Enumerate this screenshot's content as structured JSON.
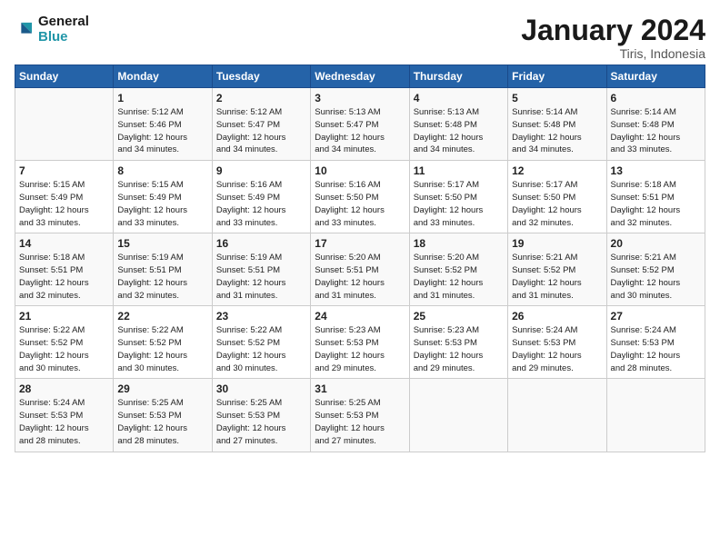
{
  "logo": {
    "line1": "General",
    "line2": "Blue"
  },
  "title": "January 2024",
  "subtitle": "Tiris, Indonesia",
  "days_header": [
    "Sunday",
    "Monday",
    "Tuesday",
    "Wednesday",
    "Thursday",
    "Friday",
    "Saturday"
  ],
  "weeks": [
    [
      {
        "day": "",
        "info": ""
      },
      {
        "day": "1",
        "info": "Sunrise: 5:12 AM\nSunset: 5:46 PM\nDaylight: 12 hours\nand 34 minutes."
      },
      {
        "day": "2",
        "info": "Sunrise: 5:12 AM\nSunset: 5:47 PM\nDaylight: 12 hours\nand 34 minutes."
      },
      {
        "day": "3",
        "info": "Sunrise: 5:13 AM\nSunset: 5:47 PM\nDaylight: 12 hours\nand 34 minutes."
      },
      {
        "day": "4",
        "info": "Sunrise: 5:13 AM\nSunset: 5:48 PM\nDaylight: 12 hours\nand 34 minutes."
      },
      {
        "day": "5",
        "info": "Sunrise: 5:14 AM\nSunset: 5:48 PM\nDaylight: 12 hours\nand 34 minutes."
      },
      {
        "day": "6",
        "info": "Sunrise: 5:14 AM\nSunset: 5:48 PM\nDaylight: 12 hours\nand 33 minutes."
      }
    ],
    [
      {
        "day": "7",
        "info": "Sunrise: 5:15 AM\nSunset: 5:49 PM\nDaylight: 12 hours\nand 33 minutes."
      },
      {
        "day": "8",
        "info": "Sunrise: 5:15 AM\nSunset: 5:49 PM\nDaylight: 12 hours\nand 33 minutes."
      },
      {
        "day": "9",
        "info": "Sunrise: 5:16 AM\nSunset: 5:49 PM\nDaylight: 12 hours\nand 33 minutes."
      },
      {
        "day": "10",
        "info": "Sunrise: 5:16 AM\nSunset: 5:50 PM\nDaylight: 12 hours\nand 33 minutes."
      },
      {
        "day": "11",
        "info": "Sunrise: 5:17 AM\nSunset: 5:50 PM\nDaylight: 12 hours\nand 33 minutes."
      },
      {
        "day": "12",
        "info": "Sunrise: 5:17 AM\nSunset: 5:50 PM\nDaylight: 12 hours\nand 32 minutes."
      },
      {
        "day": "13",
        "info": "Sunrise: 5:18 AM\nSunset: 5:51 PM\nDaylight: 12 hours\nand 32 minutes."
      }
    ],
    [
      {
        "day": "14",
        "info": "Sunrise: 5:18 AM\nSunset: 5:51 PM\nDaylight: 12 hours\nand 32 minutes."
      },
      {
        "day": "15",
        "info": "Sunrise: 5:19 AM\nSunset: 5:51 PM\nDaylight: 12 hours\nand 32 minutes."
      },
      {
        "day": "16",
        "info": "Sunrise: 5:19 AM\nSunset: 5:51 PM\nDaylight: 12 hours\nand 31 minutes."
      },
      {
        "day": "17",
        "info": "Sunrise: 5:20 AM\nSunset: 5:51 PM\nDaylight: 12 hours\nand 31 minutes."
      },
      {
        "day": "18",
        "info": "Sunrise: 5:20 AM\nSunset: 5:52 PM\nDaylight: 12 hours\nand 31 minutes."
      },
      {
        "day": "19",
        "info": "Sunrise: 5:21 AM\nSunset: 5:52 PM\nDaylight: 12 hours\nand 31 minutes."
      },
      {
        "day": "20",
        "info": "Sunrise: 5:21 AM\nSunset: 5:52 PM\nDaylight: 12 hours\nand 30 minutes."
      }
    ],
    [
      {
        "day": "21",
        "info": "Sunrise: 5:22 AM\nSunset: 5:52 PM\nDaylight: 12 hours\nand 30 minutes."
      },
      {
        "day": "22",
        "info": "Sunrise: 5:22 AM\nSunset: 5:52 PM\nDaylight: 12 hours\nand 30 minutes."
      },
      {
        "day": "23",
        "info": "Sunrise: 5:22 AM\nSunset: 5:52 PM\nDaylight: 12 hours\nand 30 minutes."
      },
      {
        "day": "24",
        "info": "Sunrise: 5:23 AM\nSunset: 5:53 PM\nDaylight: 12 hours\nand 29 minutes."
      },
      {
        "day": "25",
        "info": "Sunrise: 5:23 AM\nSunset: 5:53 PM\nDaylight: 12 hours\nand 29 minutes."
      },
      {
        "day": "26",
        "info": "Sunrise: 5:24 AM\nSunset: 5:53 PM\nDaylight: 12 hours\nand 29 minutes."
      },
      {
        "day": "27",
        "info": "Sunrise: 5:24 AM\nSunset: 5:53 PM\nDaylight: 12 hours\nand 28 minutes."
      }
    ],
    [
      {
        "day": "28",
        "info": "Sunrise: 5:24 AM\nSunset: 5:53 PM\nDaylight: 12 hours\nand 28 minutes."
      },
      {
        "day": "29",
        "info": "Sunrise: 5:25 AM\nSunset: 5:53 PM\nDaylight: 12 hours\nand 28 minutes."
      },
      {
        "day": "30",
        "info": "Sunrise: 5:25 AM\nSunset: 5:53 PM\nDaylight: 12 hours\nand 27 minutes."
      },
      {
        "day": "31",
        "info": "Sunrise: 5:25 AM\nSunset: 5:53 PM\nDaylight: 12 hours\nand 27 minutes."
      },
      {
        "day": "",
        "info": ""
      },
      {
        "day": "",
        "info": ""
      },
      {
        "day": "",
        "info": ""
      }
    ]
  ]
}
